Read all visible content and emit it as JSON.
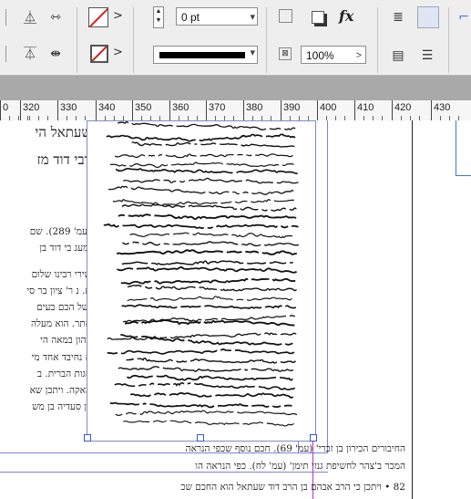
{
  "control_panel": {
    "stroke_weight_value": "0 pt",
    "opacity_value": "100%",
    "fx_label": "fx",
    "dropdown_arrow": "▾",
    "submenu_arrow": ">",
    "icons": [
      "align-top-icon",
      "distribute-horizontal-icon",
      "align-bottom-icon",
      "distribute-center-icon",
      "fill-swatch-icon",
      "stroke-swatch-icon",
      "drop-shadow-icon",
      "frame-fit-icon",
      "effects-icon",
      "text-wrap-icon"
    ]
  },
  "ruler": {
    "labels": [
      "0",
      "320",
      "330",
      "340",
      "350",
      "360",
      "370",
      "380",
      "390",
      "400",
      "410",
      "420",
      "430"
    ]
  },
  "document": {
    "heading_line_1": "שעתאל הי",
    "heading_line_2": "רבי דוד מז",
    "left_lines": [
      "(עמ' 289). שם",
      "ומעג בי דוד בן",
      "שירי רבינו שלום",
      "ם. נ ר' ציון בר סי",
      "ישל הכם בעים",
      "אתר. הוא מעלה",
      "ויהון במאה הי",
      "א נחיבד אחד מי",
      "סגות הברית. ב",
      "האקה. ויתכן שא",
      "בן סעדיה בן מש"
    ],
    "bottom_lines": [
      "החיבורים הכירון בן זכרי' (עמ' 69). חכם נוסף שכפי הנראה",
      "המכר ב'צהר לחשיפת גנזי תימן' (עמ' לח). כפי הנראה הו",
      "82 • ויתכן כי הרב אבהם בן הרב דוד שעתאל הוא החכם שכ"
    ]
  }
}
